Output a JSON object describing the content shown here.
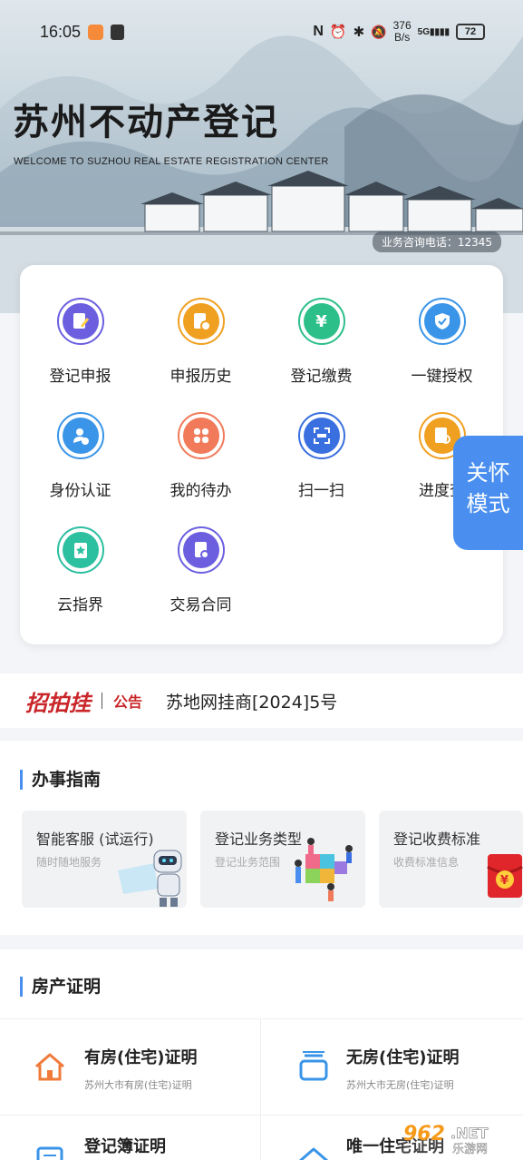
{
  "status_bar": {
    "time": "16:05",
    "net_speed_top": "376",
    "net_speed_bottom": "B/s",
    "signal": "5G",
    "battery": "72"
  },
  "header": {
    "title": "苏州不动产登记",
    "subtitle": "WELCOME TO SUZHOU REAL ESTATE REGISTRATION CENTER",
    "hotline": "业务咨询电话：12345"
  },
  "services": [
    {
      "label": "登记申报",
      "icon": "edit-document-icon",
      "color": "#6b5fe0"
    },
    {
      "label": "申报历史",
      "icon": "history-document-icon",
      "color": "#f0a020"
    },
    {
      "label": "登记缴费",
      "icon": "money-bag-icon",
      "color": "#2cbf8a"
    },
    {
      "label": "一键授权",
      "icon": "shield-check-icon",
      "color": "#3a95e8"
    },
    {
      "label": "身份认证",
      "icon": "user-verify-icon",
      "color": "#3a95e8"
    },
    {
      "label": "我的待办",
      "icon": "grid-apps-icon",
      "color": "#f07a5a"
    },
    {
      "label": "扫一扫",
      "icon": "scan-icon",
      "color": "#3a6fe0"
    },
    {
      "label": "进度查",
      "icon": "progress-search-icon",
      "color": "#f0a020"
    },
    {
      "label": "云指界",
      "icon": "cloud-boundary-icon",
      "color": "#2cbfa0"
    },
    {
      "label": "交易合同",
      "icon": "contract-icon",
      "color": "#6b5fe0"
    }
  ],
  "care_mode": {
    "line1": "关怀",
    "line2": "模式"
  },
  "notice": {
    "brand": "招拍挂",
    "tag": "公告",
    "text": "苏地网挂商[2024]5号"
  },
  "guide": {
    "title": "办事指南",
    "cards": [
      {
        "title": "智能客服 (试运行)",
        "subtitle": "随时随地服务",
        "image": "robot-illustration"
      },
      {
        "title": "登记业务类型",
        "subtitle": "登记业务范围",
        "image": "puzzle-people-illustration"
      },
      {
        "title": "登记收费标准",
        "subtitle": "收费标准信息",
        "image": "red-envelope-yuan-illustration"
      }
    ]
  },
  "certificates": {
    "title": "房产证明",
    "items": [
      {
        "title": "有房(住宅)证明",
        "subtitle": "苏州大市有房(住宅)证明",
        "icon": "house-icon"
      },
      {
        "title": "无房(住宅)证明",
        "subtitle": "苏州大市无房(住宅)证明",
        "icon": "empty-box-icon"
      },
      {
        "title": "登记簿证明",
        "subtitle": "",
        "icon": "register-book-icon"
      },
      {
        "title": "唯一住宅证明",
        "subtitle": "",
        "icon": "single-house-icon"
      }
    ]
  },
  "watermark": "962.NET 乐游网",
  "colors": {
    "accent": "#4a8ff0",
    "brand_red": "#c9262a"
  }
}
